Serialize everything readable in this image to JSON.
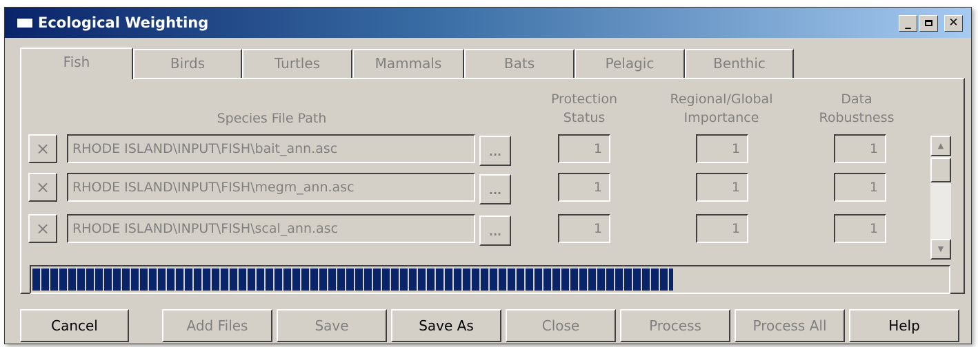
{
  "window": {
    "title": "Ecological Weighting"
  },
  "tabs": [
    {
      "label": "Fish",
      "active": true
    },
    {
      "label": "Birds",
      "active": false
    },
    {
      "label": "Turtles",
      "active": false
    },
    {
      "label": "Mammals",
      "active": false
    },
    {
      "label": "Bats",
      "active": false
    },
    {
      "label": "Pelagic",
      "active": false
    },
    {
      "label": "Benthic",
      "active": false
    }
  ],
  "columns": {
    "species_path": "Species File Path",
    "protection_l1": "Protection",
    "protection_l2": "Status",
    "importance_l1": "Regional/Global",
    "importance_l2": "Importance",
    "robustness_l1": "Data",
    "robustness_l2": "Robustness"
  },
  "rows": [
    {
      "path": "RHODE ISLAND\\INPUT\\FISH\\bait_ann.asc",
      "protection": "1",
      "importance": "1",
      "robustness": "1"
    },
    {
      "path": "RHODE ISLAND\\INPUT\\FISH\\megm_ann.asc",
      "protection": "1",
      "importance": "1",
      "robustness": "1"
    },
    {
      "path": "RHODE ISLAND\\INPUT\\FISH\\scal_ann.asc",
      "protection": "1",
      "importance": "1",
      "robustness": "1"
    }
  ],
  "icons": {
    "remove": "×",
    "browse": "...",
    "scroll_up": "▲",
    "scroll_down": "▼"
  },
  "progress": {
    "fraction": 0.7,
    "color": "#0a246a"
  },
  "buttons": {
    "cancel": "Cancel",
    "add_files": "Add Files",
    "save": "Save",
    "save_as": "Save As",
    "close": "Close",
    "process": "Process",
    "process_all": "Process All",
    "help": "Help"
  },
  "colors": {
    "title_gradient_start": "#0a246a",
    "title_gradient_end": "#a6caf0",
    "face": "#d4d0c8"
  }
}
